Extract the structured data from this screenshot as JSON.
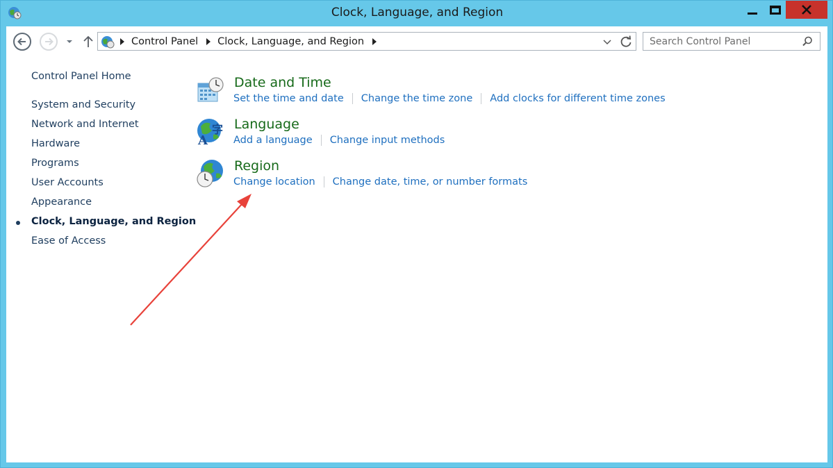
{
  "window": {
    "title": "Clock, Language, and Region"
  },
  "nav": {
    "breadcrumb": [
      "Control Panel",
      "Clock, Language, and Region"
    ]
  },
  "search": {
    "placeholder": "Search Control Panel"
  },
  "sidebar": {
    "home": "Control Panel Home",
    "items": [
      {
        "label": "System and Security"
      },
      {
        "label": "Network and Internet"
      },
      {
        "label": "Hardware"
      },
      {
        "label": "Programs"
      },
      {
        "label": "User Accounts"
      },
      {
        "label": "Appearance"
      },
      {
        "label": "Clock, Language, and Region",
        "active": true
      },
      {
        "label": "Ease of Access"
      }
    ]
  },
  "categories": [
    {
      "title": "Date and Time",
      "icon": "calendar-clock-icon",
      "links": [
        "Set the time and date",
        "Change the time zone",
        "Add clocks for different time zones"
      ]
    },
    {
      "title": "Language",
      "icon": "language-globe-icon",
      "links": [
        "Add a language",
        "Change input methods"
      ]
    },
    {
      "title": "Region",
      "icon": "region-globe-clock-icon",
      "links": [
        "Change location",
        "Change date, time, or number formats"
      ]
    }
  ],
  "colors": {
    "window_frame": "#66c8e9",
    "close_button": "#c7322b",
    "category_title": "#176a1a",
    "link": "#1e6fbf",
    "annotation_arrow": "#e8423a"
  }
}
